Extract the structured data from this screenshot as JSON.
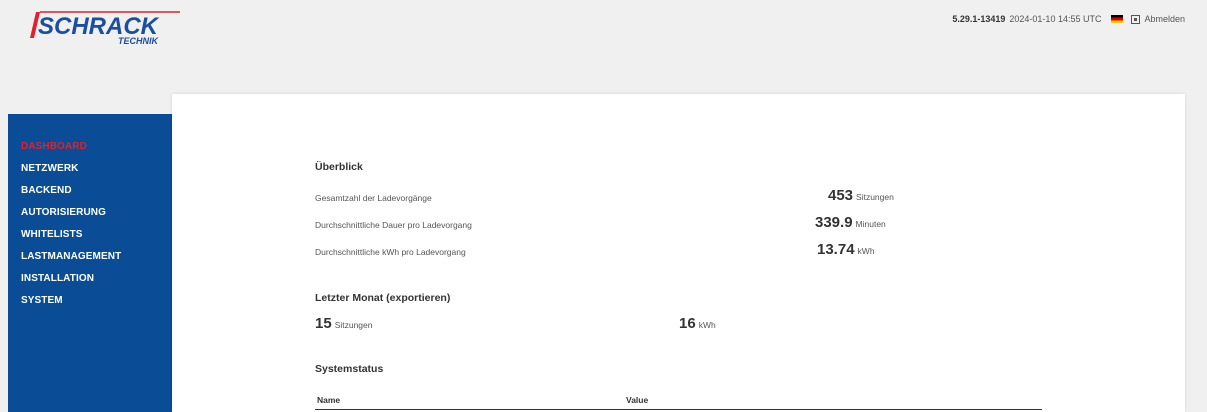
{
  "brand": {
    "logo_word": "SCHRACK",
    "logo_sub": "TECHNIK",
    "color": "#0a4c96",
    "accent": "#e0202c"
  },
  "topbar": {
    "version": "5.29.1-13419",
    "datetime": "2024-01-10 14:55 UTC",
    "language_flag": "flag-de-icon",
    "logout_label": "Abmelden"
  },
  "sidebar": {
    "items": [
      {
        "label": "DASHBOARD",
        "active": true
      },
      {
        "label": "NETZWERK"
      },
      {
        "label": "BACKEND"
      },
      {
        "label": "AUTORISIERUNG"
      },
      {
        "label": "WHITELISTS"
      },
      {
        "label": "LASTMANAGEMENT"
      },
      {
        "label": "INSTALLATION"
      },
      {
        "label": "SYSTEM"
      }
    ]
  },
  "overview": {
    "title": "Überblick",
    "rows": [
      {
        "label": "Gesamtzahl der Ladevorgänge",
        "value": "453",
        "unit": "Sitzungen"
      },
      {
        "label": "Durchschnittliche Dauer pro Ladevorgang",
        "value": "339.9",
        "unit": "Minuten"
      },
      {
        "label": "Durchschnittliche kWh pro Ladevorgang",
        "value": "13.74",
        "unit": "kWh"
      }
    ]
  },
  "last_month": {
    "title": "Letzter Monat (exportieren)",
    "sessions_value": "15",
    "sessions_unit": "Sitzungen",
    "kwh_value": "16",
    "kwh_unit": "kWh"
  },
  "system_status": {
    "title": "Systemstatus",
    "columns": [
      "Name",
      "Value"
    ]
  }
}
